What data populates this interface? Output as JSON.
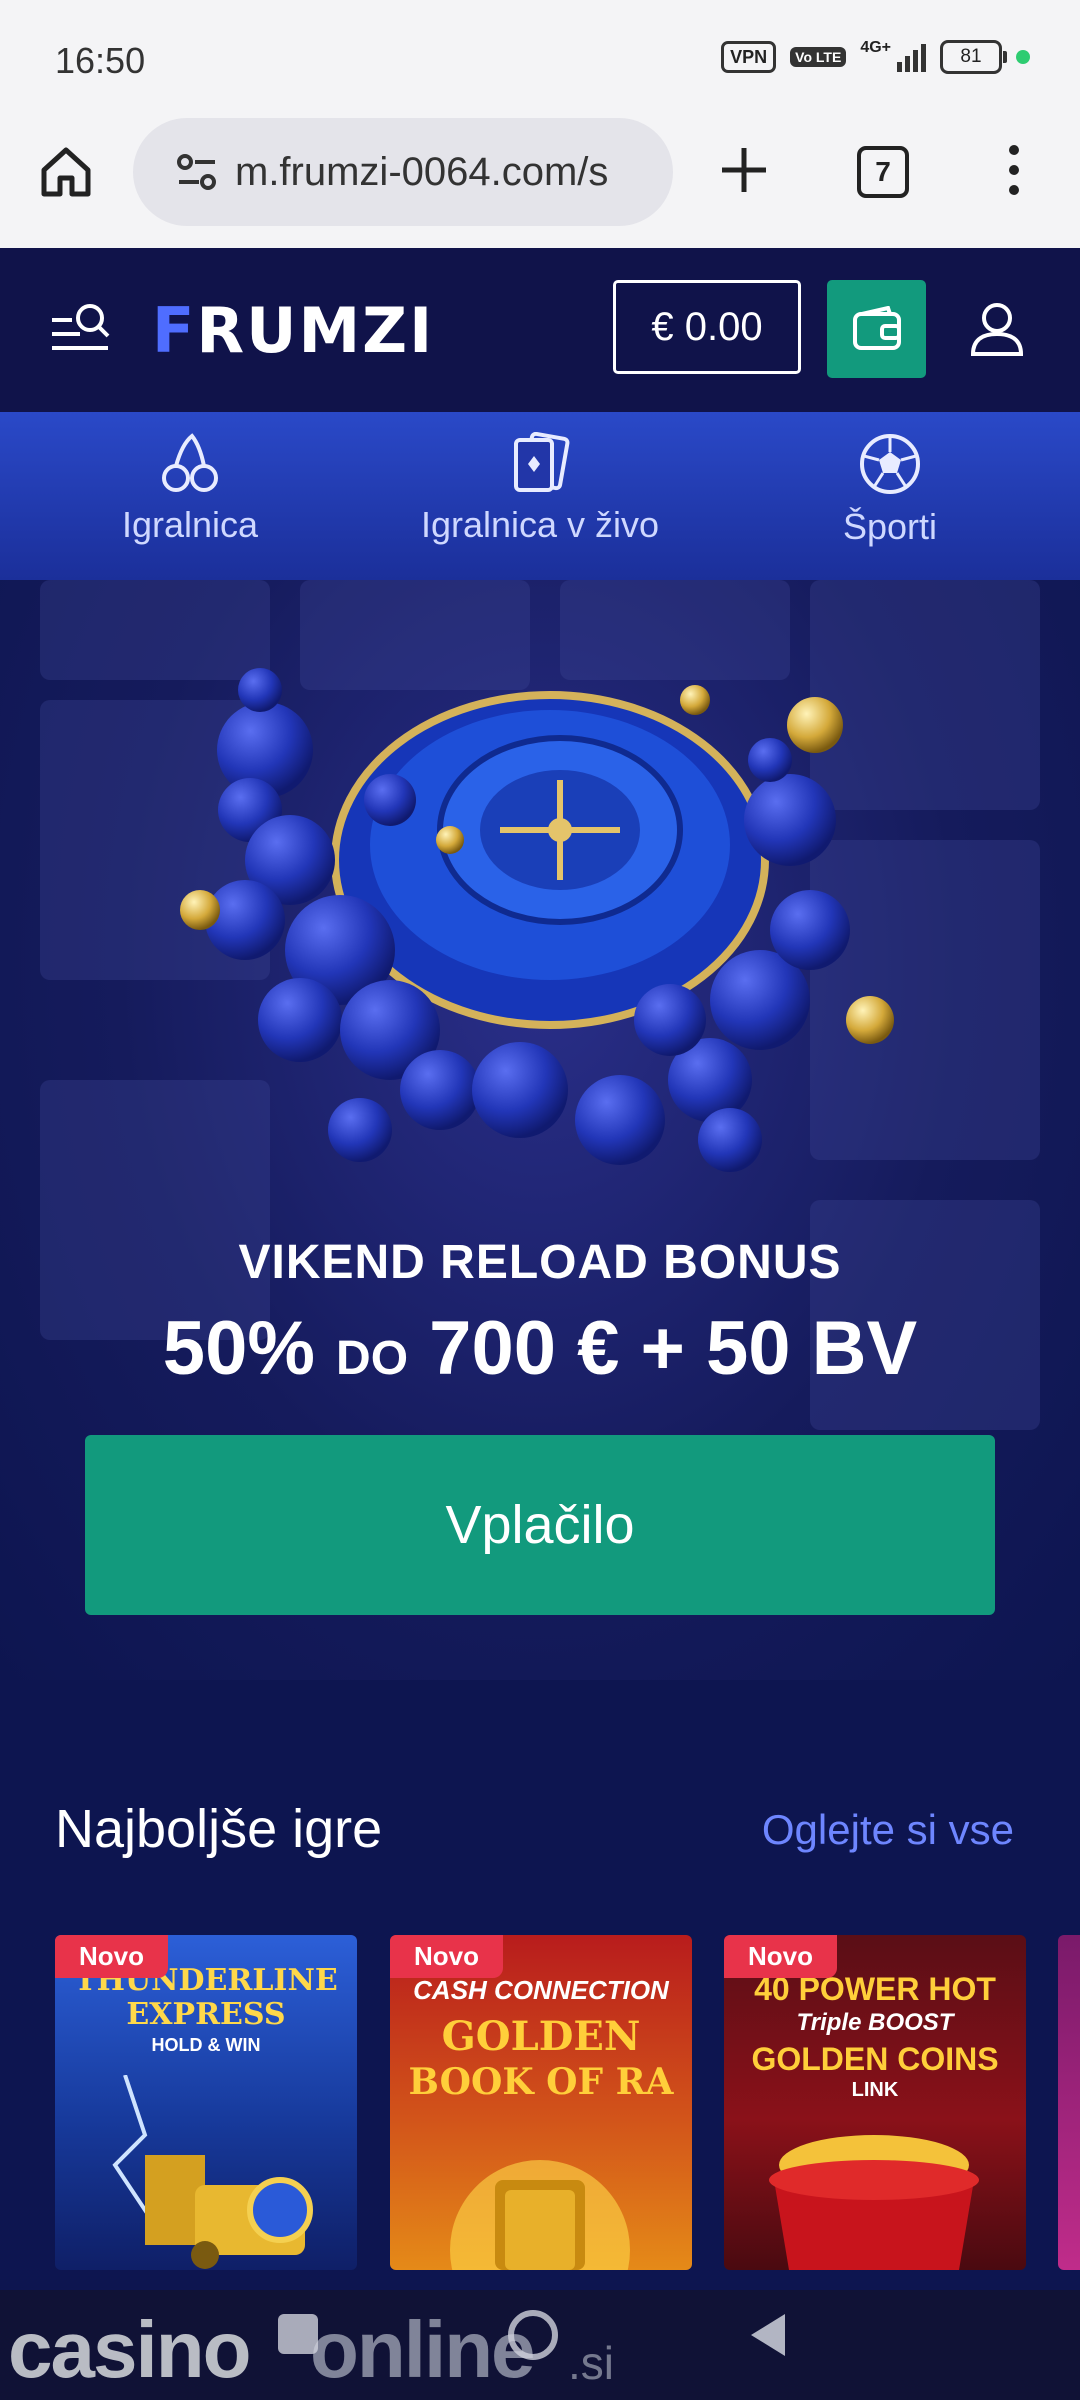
{
  "status_bar": {
    "time": "16:50",
    "vpn": "VPN",
    "volte": "Vo LTE",
    "network": "4G+",
    "battery": "81"
  },
  "browser": {
    "url": "m.frumzi-0064.com/s",
    "tab_count": "7"
  },
  "header": {
    "logo_text_accent": "F",
    "logo_text_rest": "RUMZI",
    "balance": "€ 0.00",
    "colors": {
      "header_bg": "#10134a",
      "accent_green": "#129a7d",
      "logo_blue": "#4f6dff"
    }
  },
  "nav": {
    "items": [
      {
        "label": "Igralnica",
        "icon": "cherry-icon"
      },
      {
        "label": "Igralnica v živo",
        "icon": "cards-icon"
      },
      {
        "label": "Športi",
        "icon": "football-icon"
      }
    ]
  },
  "hero": {
    "subtitle": "VIKEND RELOAD BONUS",
    "title_part1": "50%",
    "title_part2": "DO",
    "title_part3": "700 € + 50 BV",
    "cta_label": "Vplačilo"
  },
  "best_games": {
    "title": "Najboljše igre",
    "see_all": "Oglejte si vse",
    "games": [
      {
        "badge": "Novo",
        "line1": "THUNDERLINE",
        "line2": "EXPRESS",
        "line3": "HOLD & WIN"
      },
      {
        "badge": "Novo",
        "line1": "CASH CONNECTION",
        "line2": "GOLDEN",
        "line3": "BOOK OF RA"
      },
      {
        "badge": "Novo",
        "line1": "40 POWER HOT",
        "line2": "Triple BOOST",
        "line3": "GOLDEN COINS",
        "line4": "LINK"
      }
    ]
  },
  "watermark": {
    "part1": "casino",
    "part2": "online",
    "part3": ".si"
  }
}
